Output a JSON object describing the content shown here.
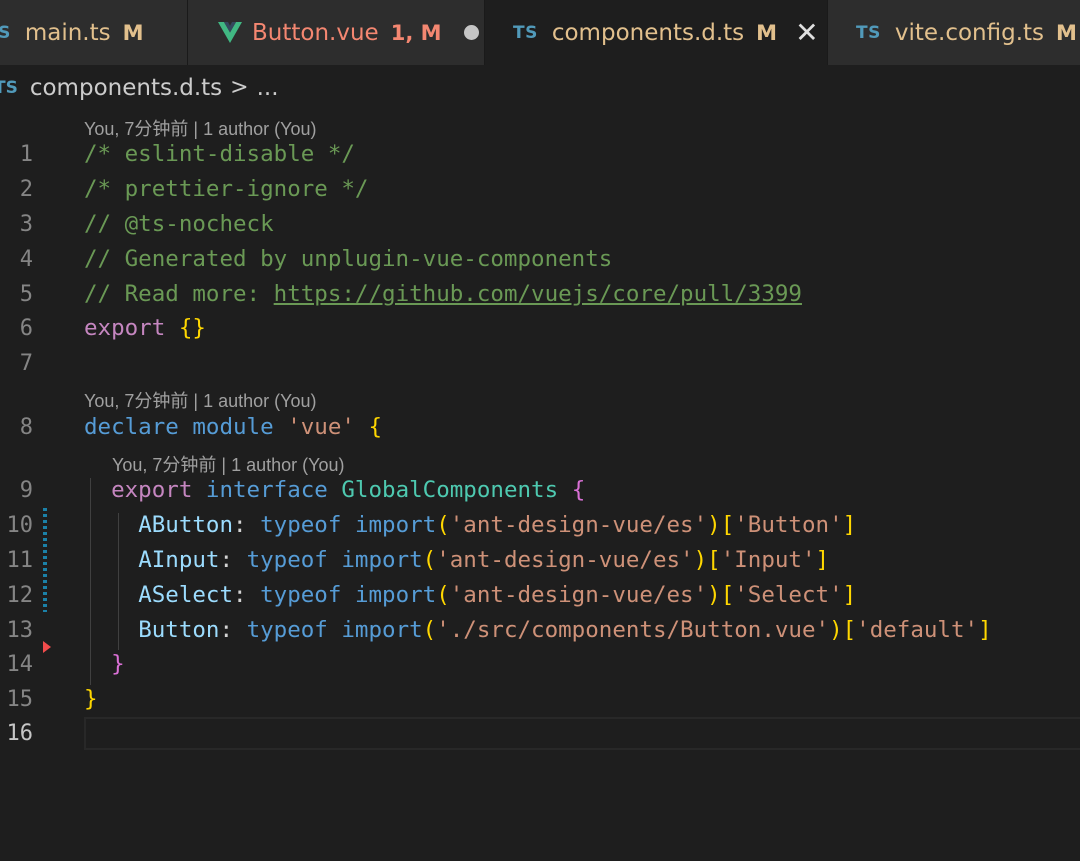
{
  "tabs": [
    {
      "icon": "ts-icon",
      "icon_text": "TS",
      "name": "main.ts",
      "badge": "M",
      "active": false
    },
    {
      "icon": "vue-icon",
      "name": "Button.vue",
      "badge": "1, M",
      "has_error": true,
      "dirty": true,
      "active": false
    },
    {
      "icon": "ts-icon",
      "icon_text": "TS",
      "name": "components.d.ts",
      "badge": "M",
      "active": true,
      "closable": true,
      "close_glyph": "✕"
    },
    {
      "icon": "ts-icon",
      "icon_text": "TS",
      "name": "vite.config.ts",
      "badge": "M",
      "active": false
    }
  ],
  "breadcrumb": {
    "icon_text": "TS",
    "file": "components.d.ts",
    "separator": ">",
    "more": "..."
  },
  "codelens": [
    {
      "text": "You, 7分钟前 | 1 author (You)"
    },
    {
      "text": "You, 7分钟前 | 1 author (You)"
    },
    {
      "text": "You, 7分钟前 | 1 author (You)"
    }
  ],
  "code_lines": [
    {
      "number": "1",
      "text": "/* eslint-disable */"
    },
    {
      "number": "2",
      "text": "/* prettier-ignore */"
    },
    {
      "number": "3",
      "text": "// @ts-nocheck"
    },
    {
      "number": "4",
      "text": "// Generated by unplugin-vue-components"
    },
    {
      "number": "5",
      "prefix": "// Read more: ",
      "link": "https://github.com/vuejs/core/pull/3399"
    },
    {
      "number": "6",
      "keyword": "export",
      "brace": "{}"
    },
    {
      "number": "7"
    },
    {
      "number": "8",
      "k1": "declare",
      "k2": "module",
      "str": "'vue'",
      "brace": "{"
    },
    {
      "number": "9",
      "k1": "export",
      "k2": "interface",
      "type": "GlobalComponents",
      "brace": "{"
    },
    {
      "number": "10",
      "prop": "AButton",
      "kw": "typeof",
      "fn": "import",
      "arg": "'ant-design-vue/es'",
      "key": "'Button'"
    },
    {
      "number": "11",
      "prop": "AInput",
      "kw": "typeof",
      "fn": "import",
      "arg": "'ant-design-vue/es'",
      "key": "'Input'"
    },
    {
      "number": "12",
      "prop": "ASelect",
      "kw": "typeof",
      "fn": "import",
      "arg": "'ant-design-vue/es'",
      "key": "'Select'"
    },
    {
      "number": "13",
      "prop": "Button",
      "kw": "typeof",
      "fn": "import",
      "arg": "'./src/components/Button.vue'",
      "key": "'default'"
    },
    {
      "number": "14",
      "brace": "}"
    },
    {
      "number": "15",
      "brace": "}"
    },
    {
      "number": "16",
      "current": true
    }
  ],
  "colors": {
    "editor_bg": "#1e1e1e",
    "comment": "#6a9955",
    "keyword": "#569cd6",
    "control_keyword": "#c586c0",
    "string": "#ce9178",
    "type": "#4ec9b0",
    "variable": "#9cdcfe",
    "function": "#dcdcaa",
    "modified_tab": "#e2c08d",
    "error_tab": "#f48771"
  }
}
